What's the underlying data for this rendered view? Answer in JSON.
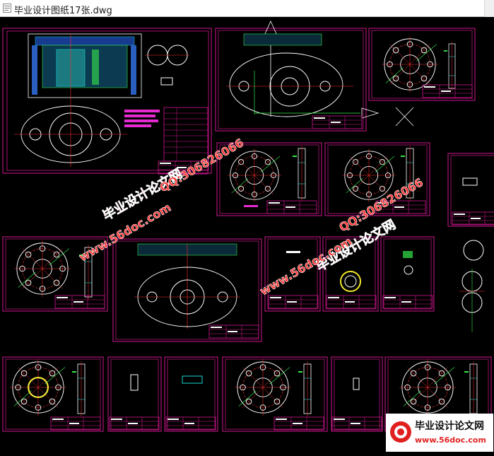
{
  "window": {
    "title": "毕业设计图纸17张.dwg",
    "icon": "dwg-file-icon"
  },
  "drawing": {
    "sheet_count": 17,
    "layout_colors": {
      "frame": "#d1168f",
      "cyan": "#16d8d8",
      "green": "#35e84a",
      "white": "#ffffff",
      "red": "#ff2f2f",
      "yellow": "#f2e52a"
    }
  },
  "watermarks": {
    "site_cn": "毕业设计论文网",
    "site_url": "www.56doc.com",
    "qq": "QQ:306826066",
    "logo_cn": "毕业设计论文网",
    "logo_url": "www.56doc.com"
  }
}
